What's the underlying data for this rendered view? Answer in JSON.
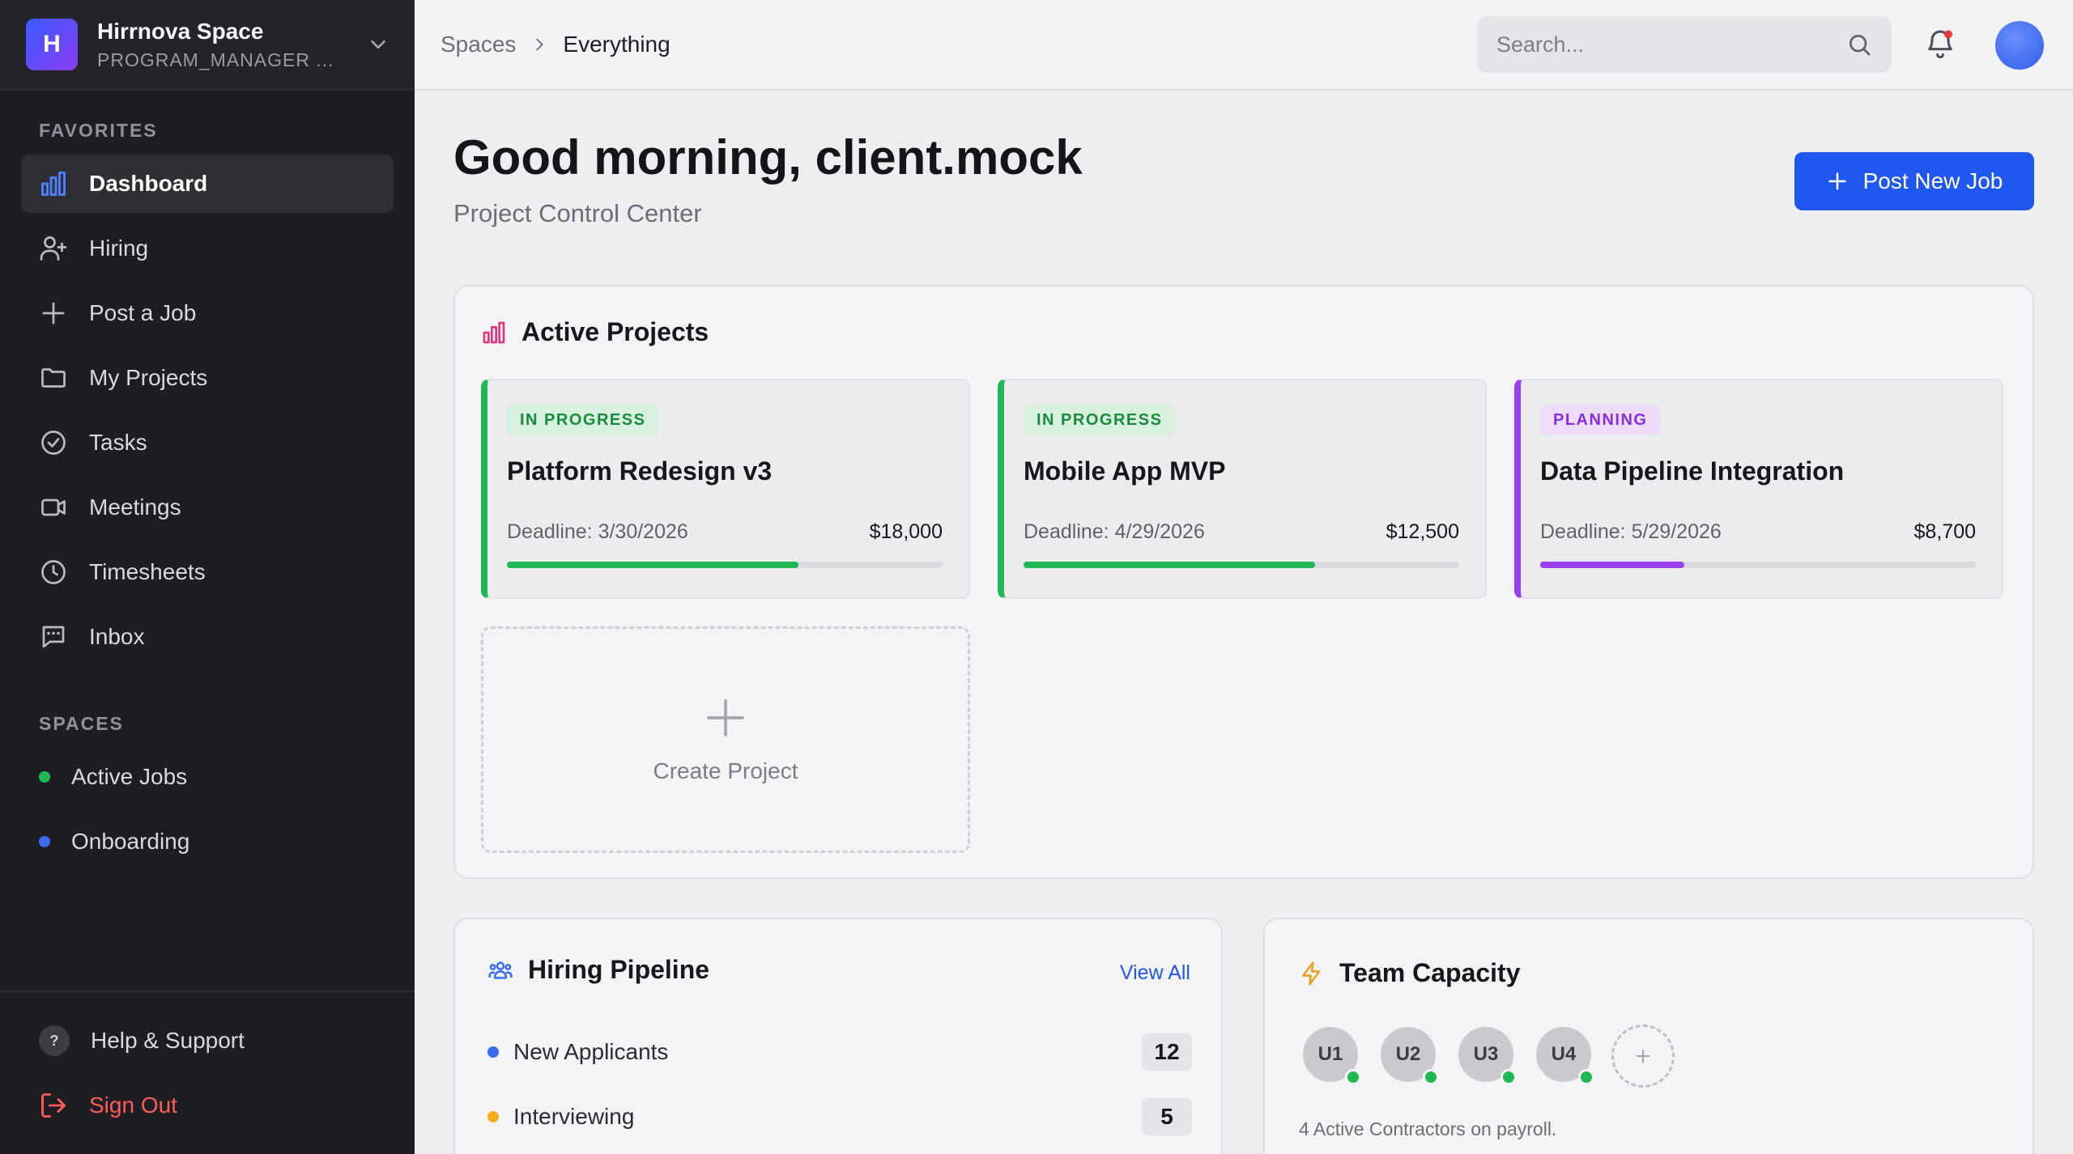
{
  "workspace": {
    "initial": "H",
    "name": "Hirrnova Space",
    "role": "PROGRAM_MANAGER ..."
  },
  "sidebar": {
    "favorites_label": "FAVORITES",
    "items": [
      {
        "label": "Dashboard",
        "icon": "bar-chart-icon",
        "active": true
      },
      {
        "label": "Hiring",
        "icon": "user-plus-icon"
      },
      {
        "label": "Post a Job",
        "icon": "plus-icon"
      },
      {
        "label": "My Projects",
        "icon": "folder-icon"
      },
      {
        "label": "Tasks",
        "icon": "check-circle-icon"
      },
      {
        "label": "Meetings",
        "icon": "video-icon"
      },
      {
        "label": "Timesheets",
        "icon": "clock-icon"
      },
      {
        "label": "Inbox",
        "icon": "message-icon"
      }
    ],
    "spaces_label": "SPACES",
    "spaces": [
      {
        "label": "Active Jobs",
        "color": "#1fb855"
      },
      {
        "label": "Onboarding",
        "color": "#3b6cf0"
      }
    ],
    "help_label": "Help & Support",
    "signout_label": "Sign Out"
  },
  "topbar": {
    "breadcrumb": {
      "root": "Spaces",
      "current": "Everything"
    },
    "search_placeholder": "Search..."
  },
  "main": {
    "greeting": "Good morning, client.mock",
    "subtitle": "Project Control Center",
    "post_job_label": "Post New Job"
  },
  "active_projects": {
    "title": "Active Projects",
    "projects": [
      {
        "status": "IN PROGRESS",
        "name": "Platform Redesign v3",
        "deadline": "Deadline: 3/30/2026",
        "budget": "$18,000",
        "progress": 0.67,
        "color": "#1fb855",
        "badge_bg": "#d8f1de",
        "badge_fg": "#1a8a3e"
      },
      {
        "status": "IN PROGRESS",
        "name": "Mobile App MVP",
        "deadline": "Deadline: 4/29/2026",
        "budget": "$12,500",
        "progress": 0.67,
        "color": "#1fb855",
        "badge_bg": "#d8f1de",
        "badge_fg": "#1a8a3e"
      },
      {
        "status": "PLANNING",
        "name": "Data Pipeline Integration",
        "deadline": "Deadline: 5/29/2026",
        "budget": "$8,700",
        "progress": 0.33,
        "color": "#9b3ff0",
        "badge_bg": "#eedcfb",
        "badge_fg": "#8a2fd9"
      }
    ],
    "create_label": "Create Project"
  },
  "hiring_pipeline": {
    "title": "Hiring Pipeline",
    "view_all": "View All",
    "rows": [
      {
        "label": "New Applicants",
        "count": "12",
        "color": "#3b6cf0"
      },
      {
        "label": "Interviewing",
        "count": "5",
        "color": "#f0b020"
      }
    ]
  },
  "team_capacity": {
    "title": "Team Capacity",
    "members": [
      "U1",
      "U2",
      "U3",
      "U4"
    ],
    "note": "4 Active Contractors on payroll."
  }
}
